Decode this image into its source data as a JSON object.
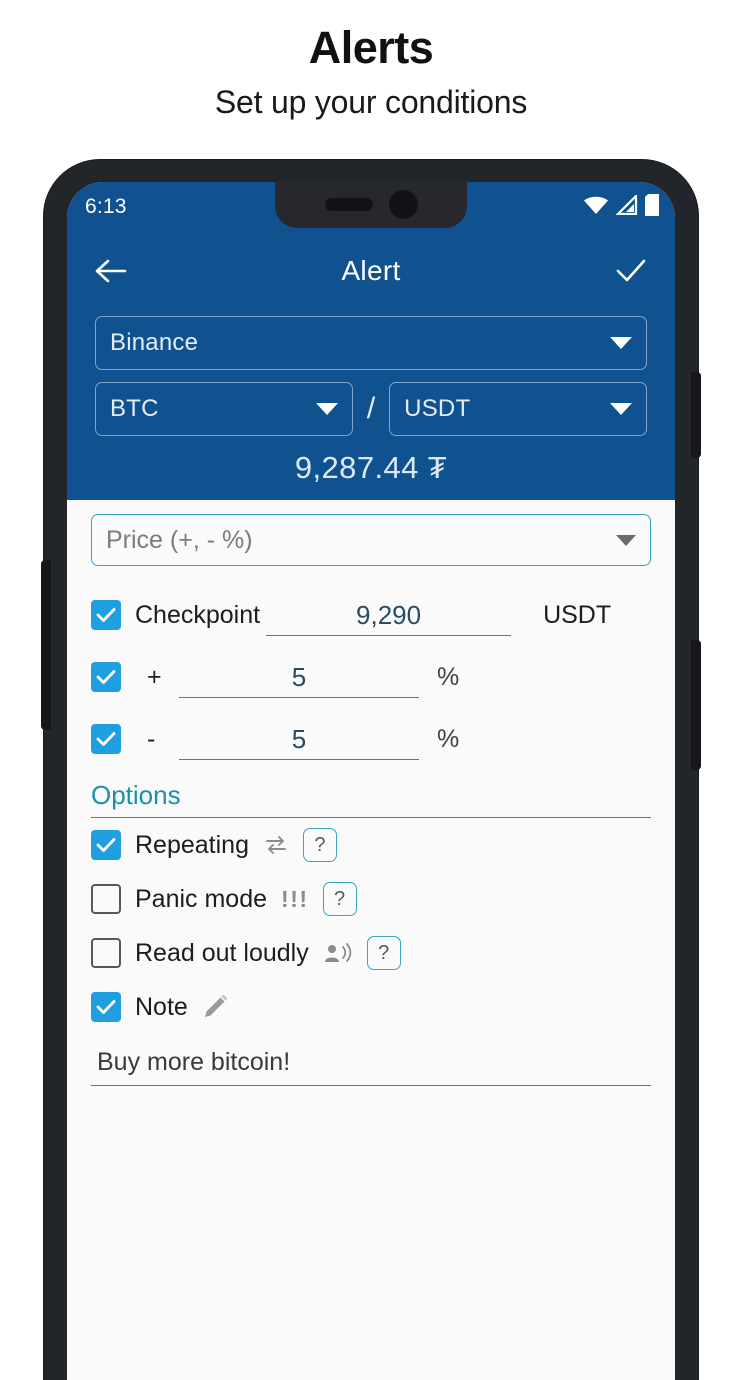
{
  "promo": {
    "title": "Alerts",
    "subtitle": "Set up your conditions"
  },
  "phone": {
    "status_bar": {
      "time": "6:13",
      "icons": [
        "wifi-icon",
        "cell-signal-icon",
        "battery-icon"
      ]
    },
    "app_bar": {
      "back_icon": "arrow-left-icon",
      "title": "Alert",
      "confirm_icon": "check-icon"
    },
    "exchange_section": {
      "exchange": {
        "value": "Binance",
        "caret_icon": "chevron-down-icon"
      },
      "base": {
        "value": "BTC",
        "caret_icon": "chevron-down-icon"
      },
      "separator": "/",
      "quote": {
        "value": "USDT",
        "caret_icon": "chevron-down-icon"
      },
      "current_price": "9,287.44 ₮"
    },
    "condition": {
      "type_select": {
        "value": "Price (+, - %)",
        "caret_icon": "chevron-down-icon"
      },
      "checkpoint": {
        "label": "Checkpoint",
        "checked": true,
        "value": "9,290",
        "unit": "USDT"
      },
      "plus": {
        "sign": "+",
        "checked": true,
        "value": "5",
        "unit": "%"
      },
      "minus": {
        "sign": "-",
        "checked": true,
        "value": "5",
        "unit": "%"
      }
    },
    "options": {
      "heading": "Options",
      "items": [
        {
          "label": "Repeating",
          "checked": true,
          "icon": "repeat-icon",
          "help": "?"
        },
        {
          "label": "Panic mode",
          "checked": false,
          "icon": "exclamation-triple-icon",
          "icon_text": "!!!",
          "help": "?"
        },
        {
          "label": "Read out loudly",
          "checked": false,
          "icon": "person-speaking-icon",
          "help": "?"
        },
        {
          "label": "Note",
          "checked": true,
          "icon": "pencil-icon",
          "help": ""
        }
      ],
      "note_text": "Buy more bitcoin!"
    }
  },
  "colors": {
    "header_blue": "#10528f",
    "checkbox_blue": "#1f9fe0",
    "accent_teal": "#1a90ab",
    "frame_dark": "#22252a",
    "screen_bg": "#fafafa"
  }
}
